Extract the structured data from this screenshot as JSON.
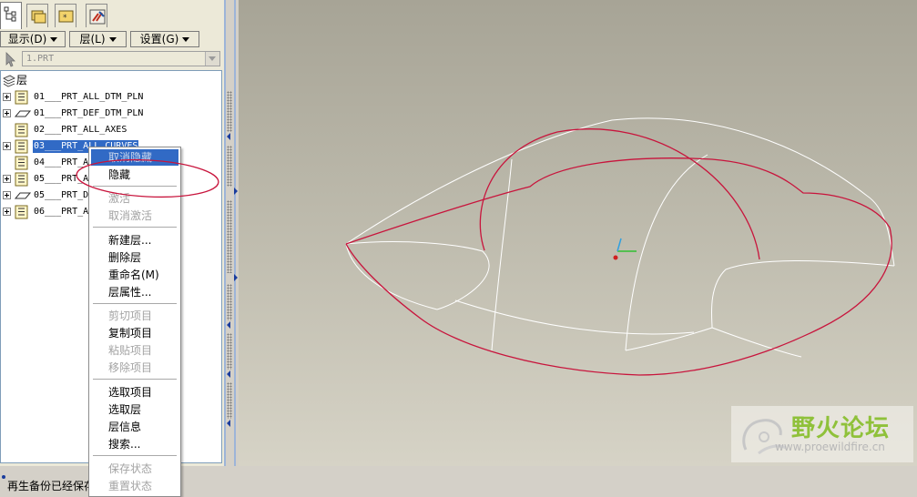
{
  "model_tree": {
    "tabs": [
      "layer-tree",
      "folder-browser",
      "favorites",
      "connections"
    ],
    "menu": {
      "show_label": "显示(D)",
      "layer_label": "层(L)",
      "settings_label": "设置(G)"
    },
    "model_selector": "1.PRT",
    "root_label": "层",
    "layers": [
      {
        "name": "01___PRT_ALL_DTM_PLN",
        "icon": "layer-list-icon"
      },
      {
        "name": "01___PRT_DEF_DTM_PLN",
        "icon": "datum-plane-icon"
      },
      {
        "name": "02___PRT_ALL_AXES",
        "icon": "layer-list-icon"
      },
      {
        "name": "03___PRT_ALL_CURVES",
        "icon": "layer-list-icon"
      },
      {
        "name": "04___PRT_A",
        "icon": "layer-list-icon"
      },
      {
        "name": "05___PRT_A",
        "icon": "layer-list-icon"
      },
      {
        "name": "05___PRT_D",
        "icon": "datum-plane-icon"
      },
      {
        "name": "06___PRT_A",
        "icon": "layer-list-icon"
      }
    ]
  },
  "context_menu": {
    "items": [
      {
        "label": "取消隐藏",
        "state": "highlighted"
      },
      {
        "label": "隐藏",
        "state": "enabled"
      },
      {
        "label": "激活",
        "state": "disabled"
      },
      {
        "label": "取消激活",
        "state": "disabled"
      },
      {
        "label": "新建层...",
        "state": "enabled"
      },
      {
        "label": "删除层",
        "state": "enabled"
      },
      {
        "label": "重命名(M)",
        "state": "enabled"
      },
      {
        "label": "层属性...",
        "state": "enabled"
      },
      {
        "label": "剪切项目",
        "state": "disabled"
      },
      {
        "label": "复制项目",
        "state": "enabled"
      },
      {
        "label": "粘贴项目",
        "state": "disabled"
      },
      {
        "label": "移除项目",
        "state": "disabled"
      },
      {
        "label": "选取项目",
        "state": "enabled"
      },
      {
        "label": "选取层",
        "state": "enabled"
      },
      {
        "label": "层信息",
        "state": "enabled"
      },
      {
        "label": "搜索...",
        "state": "enabled"
      },
      {
        "label": "保存状态",
        "state": "disabled"
      },
      {
        "label": "重置状态",
        "state": "disabled"
      }
    ]
  },
  "status_bar": {
    "message": "再生备份已经保存"
  },
  "watermark": {
    "title": "野火论坛",
    "url": "www.proewildfire.cn"
  },
  "colors": {
    "selection": "#316ac5",
    "curve_highlight": "#c8143c",
    "annotation": "#c8143c",
    "wireframe": "#ffffff"
  }
}
